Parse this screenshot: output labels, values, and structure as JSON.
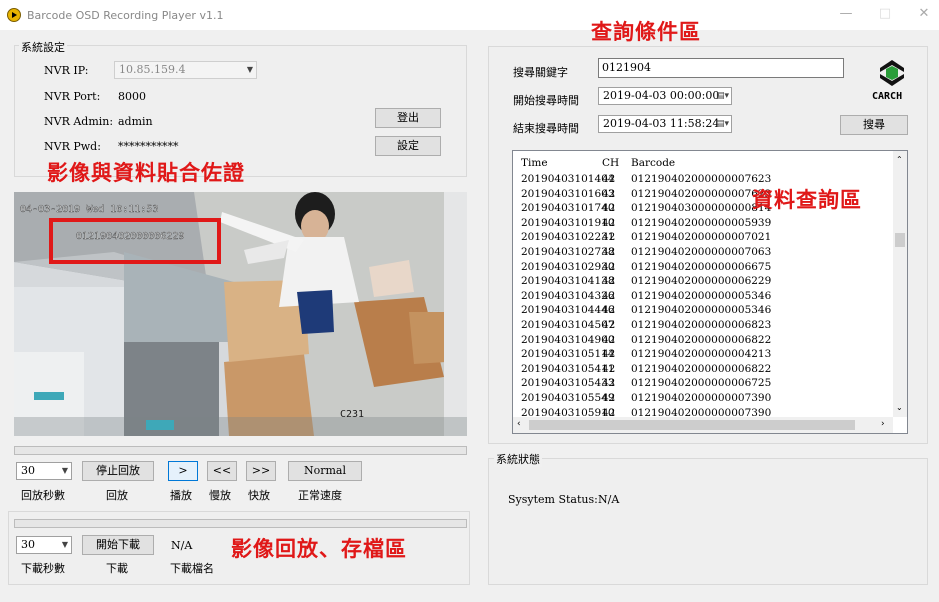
{
  "window": {
    "title": "Barcode OSD Recording Player v1.1",
    "minimize": "—",
    "maximize": "□",
    "close": "✕"
  },
  "settings": {
    "group_title": "系統設定",
    "nvr_ip_label": "NVR IP:",
    "nvr_ip_value": "10.85.159.4",
    "nvr_port_label": "NVR Port:",
    "nvr_port_value": "8000",
    "nvr_admin_label": "NVR Admin:",
    "nvr_admin_value": "admin",
    "nvr_pwd_label": "NVR Pwd:",
    "nvr_pwd_value": "***********",
    "logout_button": "登出",
    "set_button": "設定"
  },
  "annotations": {
    "video_note": "影像與資料貼合佐證",
    "query_note": "查詢條件區",
    "data_note": "資料查詢區",
    "playback_note": "影像回放、存檔區"
  },
  "video": {
    "osd_datetime": "04-03-2019 Wed 10:11:53",
    "osd_barcode": "012190402000006229",
    "camera_label": "C231"
  },
  "playback": {
    "seconds_value": "30",
    "stop_button": "停止回放",
    "play_button": ">",
    "slow_button": "<<",
    "fast_button": ">>",
    "normal_button": "Normal",
    "seconds_caption": "回放秒數",
    "playback_caption": "回放",
    "play_caption": "播放",
    "slow_caption": "慢放",
    "fast_caption": "快放",
    "normal_caption": "正常速度"
  },
  "download": {
    "seconds_value": "30",
    "start_button": "開始下載",
    "filename_value": "N/A",
    "seconds_caption": "下載秒數",
    "download_caption": "下載",
    "filename_caption": "下載檔名"
  },
  "query": {
    "keyword_label": "搜尋關鍵字",
    "keyword_value": "0121904",
    "start_label": "開始搜尋時間",
    "start_value": "2019-04-03 00:00:00",
    "end_label": "結束搜尋時間",
    "end_value": "2019-04-03 11:58:24",
    "search_button": "搜尋",
    "logo_text": "CARCH"
  },
  "results": {
    "columns": [
      "Time",
      "CH",
      "Barcode"
    ],
    "rows": [
      [
        "20190403101404",
        "42",
        "012190402000000007623"
      ],
      [
        "20190403101603",
        "42",
        "012190402000000007623"
      ],
      [
        "20190403101740",
        "42",
        "012190403000000000814"
      ],
      [
        "20190403101910",
        "42",
        "012190402000000005939"
      ],
      [
        "20190403102231",
        "42",
        "012190402000000007021"
      ],
      [
        "20190403102738",
        "42",
        "012190402000000007063"
      ],
      [
        "20190403102930",
        "42",
        "012190402000000006675"
      ],
      [
        "20190403104138",
        "42",
        "012190402000000006229"
      ],
      [
        "20190403104326",
        "42",
        "012190402000000005346"
      ],
      [
        "20190403104446",
        "42",
        "012190402000000005346"
      ],
      [
        "20190403104507",
        "42",
        "012190402000000006823"
      ],
      [
        "20190403104900",
        "42",
        "012190402000000006822"
      ],
      [
        "20190403105114",
        "42",
        "012190402000000004213"
      ],
      [
        "20190403105411",
        "42",
        "012190402000000006822"
      ],
      [
        "20190403105433",
        "42",
        "012190402000000006725"
      ],
      [
        "20190403105549",
        "42",
        "012190402000000007390"
      ],
      [
        "20190403105910",
        "42",
        "012190402000000007390"
      ]
    ]
  },
  "status": {
    "group_title": "系統狀態",
    "label": "Sysytem Status:",
    "value": "N/A"
  }
}
